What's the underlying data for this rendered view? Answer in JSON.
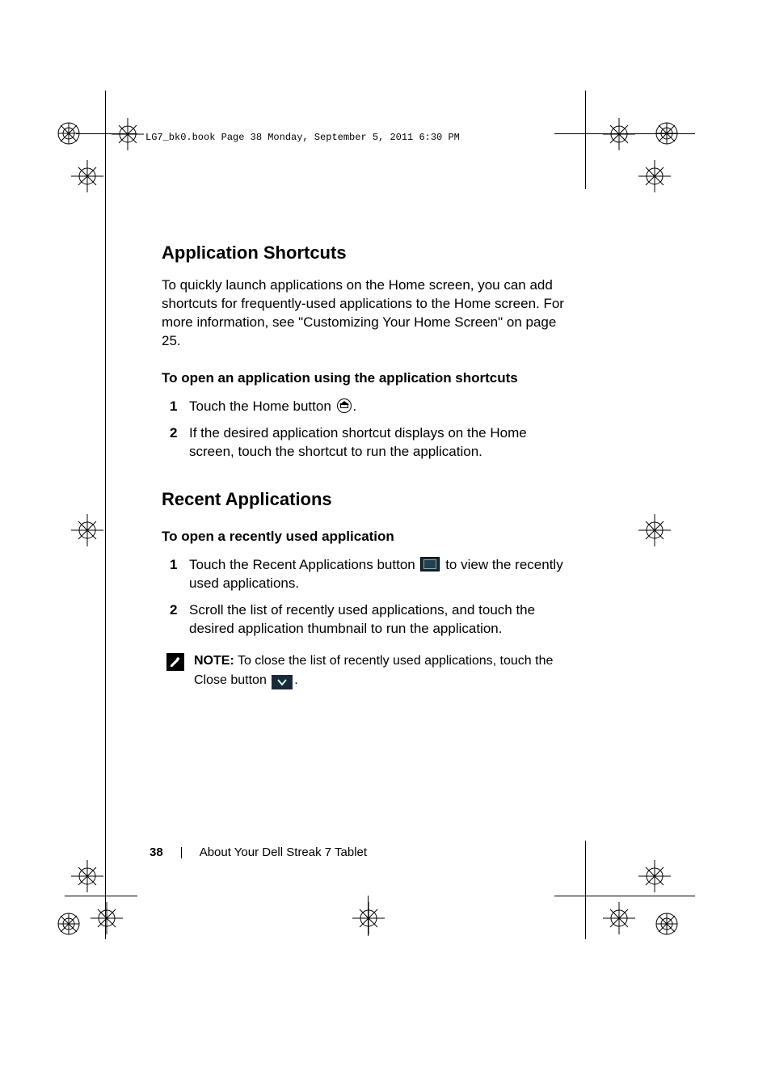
{
  "book_tag": "LG7_bk0.book  Page 38  Monday, September 5, 2011  6:30 PM",
  "section1": {
    "title": "Application Shortcuts",
    "lead": "To quickly launch applications on the Home screen, you can add shortcuts for frequently-used applications to the Home screen. For more information, see \"Customizing Your Home Screen\" on page 25.",
    "sub": "To open an application using the application shortcuts",
    "step1_a": "Touch the Home button ",
    "step1_b": ".",
    "step2": "If the desired application shortcut displays on the Home screen, touch the shortcut to run the application."
  },
  "section2": {
    "title": "Recent Applications",
    "sub": "To open a recently used application",
    "step1_a": "Touch the Recent Applications button ",
    "step1_b": " to view the recently used applications.",
    "step2": "Scroll the list of recently used applications, and touch the desired application thumbnail to run the application.",
    "note_label": "NOTE:",
    "note_a": " To close the list of recently used applications, touch the Close button ",
    "note_b": "."
  },
  "footer": {
    "page": "38",
    "chapter": "About Your Dell Streak 7 Tablet"
  }
}
